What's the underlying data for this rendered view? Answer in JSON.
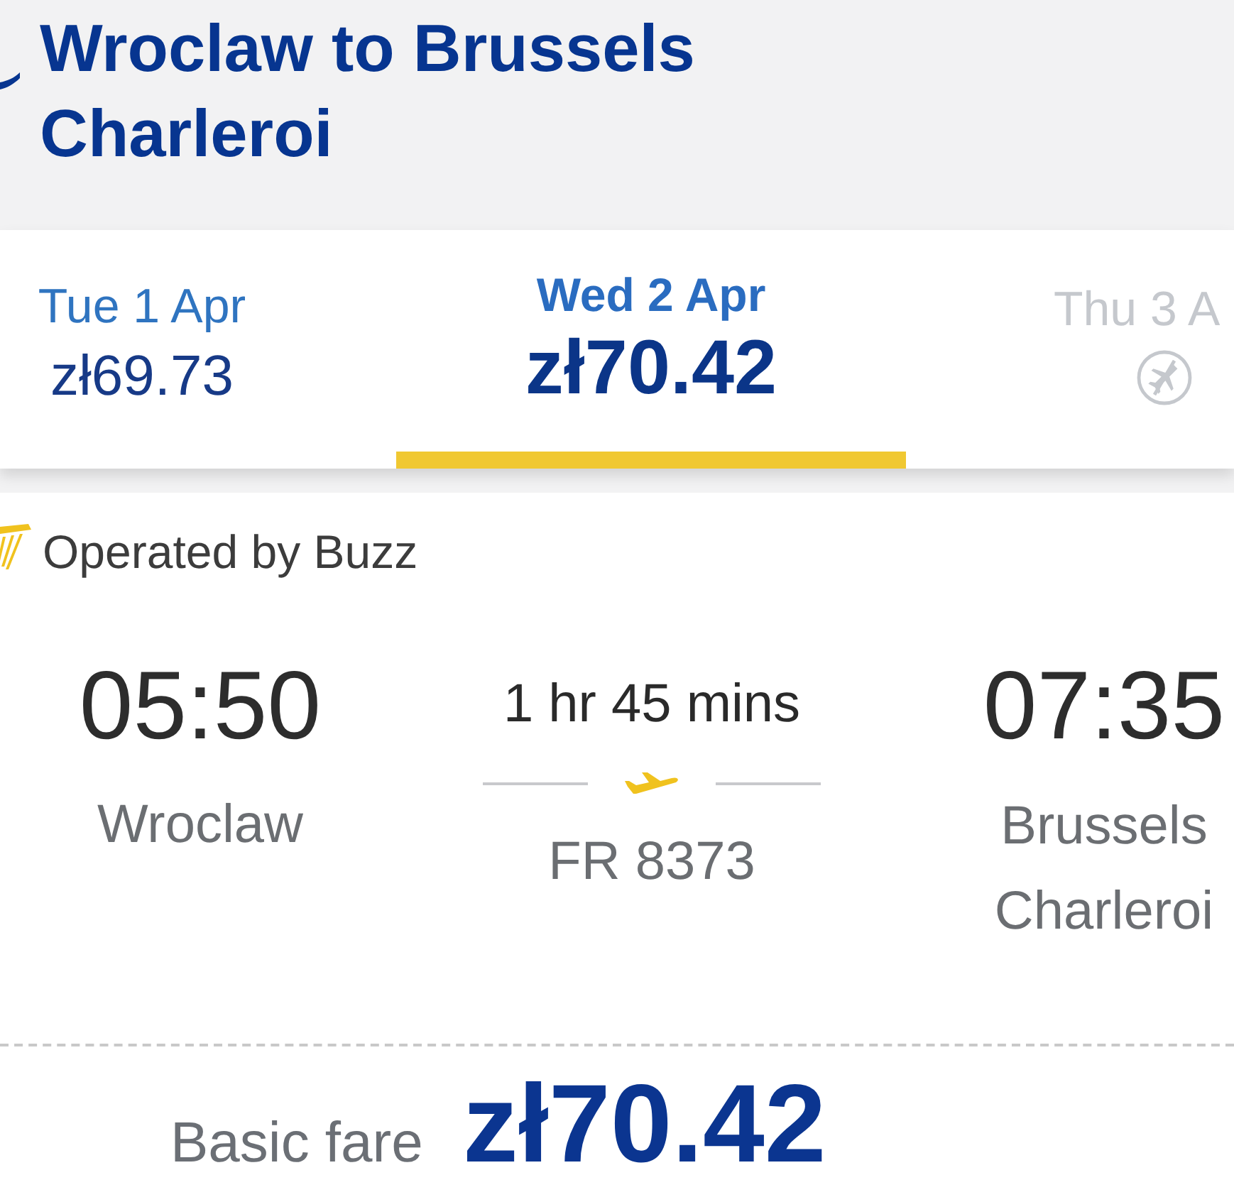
{
  "header": {
    "title": "Wroclaw to Brussels Charleroi"
  },
  "date_tabs": [
    {
      "day": "Tue 1 Apr",
      "price": "zł69.73",
      "selected": false,
      "available": true
    },
    {
      "day": "Wed 2 Apr",
      "price": "zł70.42",
      "selected": true,
      "available": true
    },
    {
      "day": "Thu 3 A",
      "selected": false,
      "available": false
    }
  ],
  "flight": {
    "operated_by": "Operated by Buzz",
    "departure": {
      "time": "05:50",
      "city": "Wroclaw"
    },
    "duration": "1 hr 45 mins",
    "flight_number": "FR 8373",
    "arrival": {
      "time": "07:35",
      "city": "Brussels Charleroi"
    }
  },
  "fare": {
    "label": "Basic fare",
    "price": "zł70.42"
  }
}
